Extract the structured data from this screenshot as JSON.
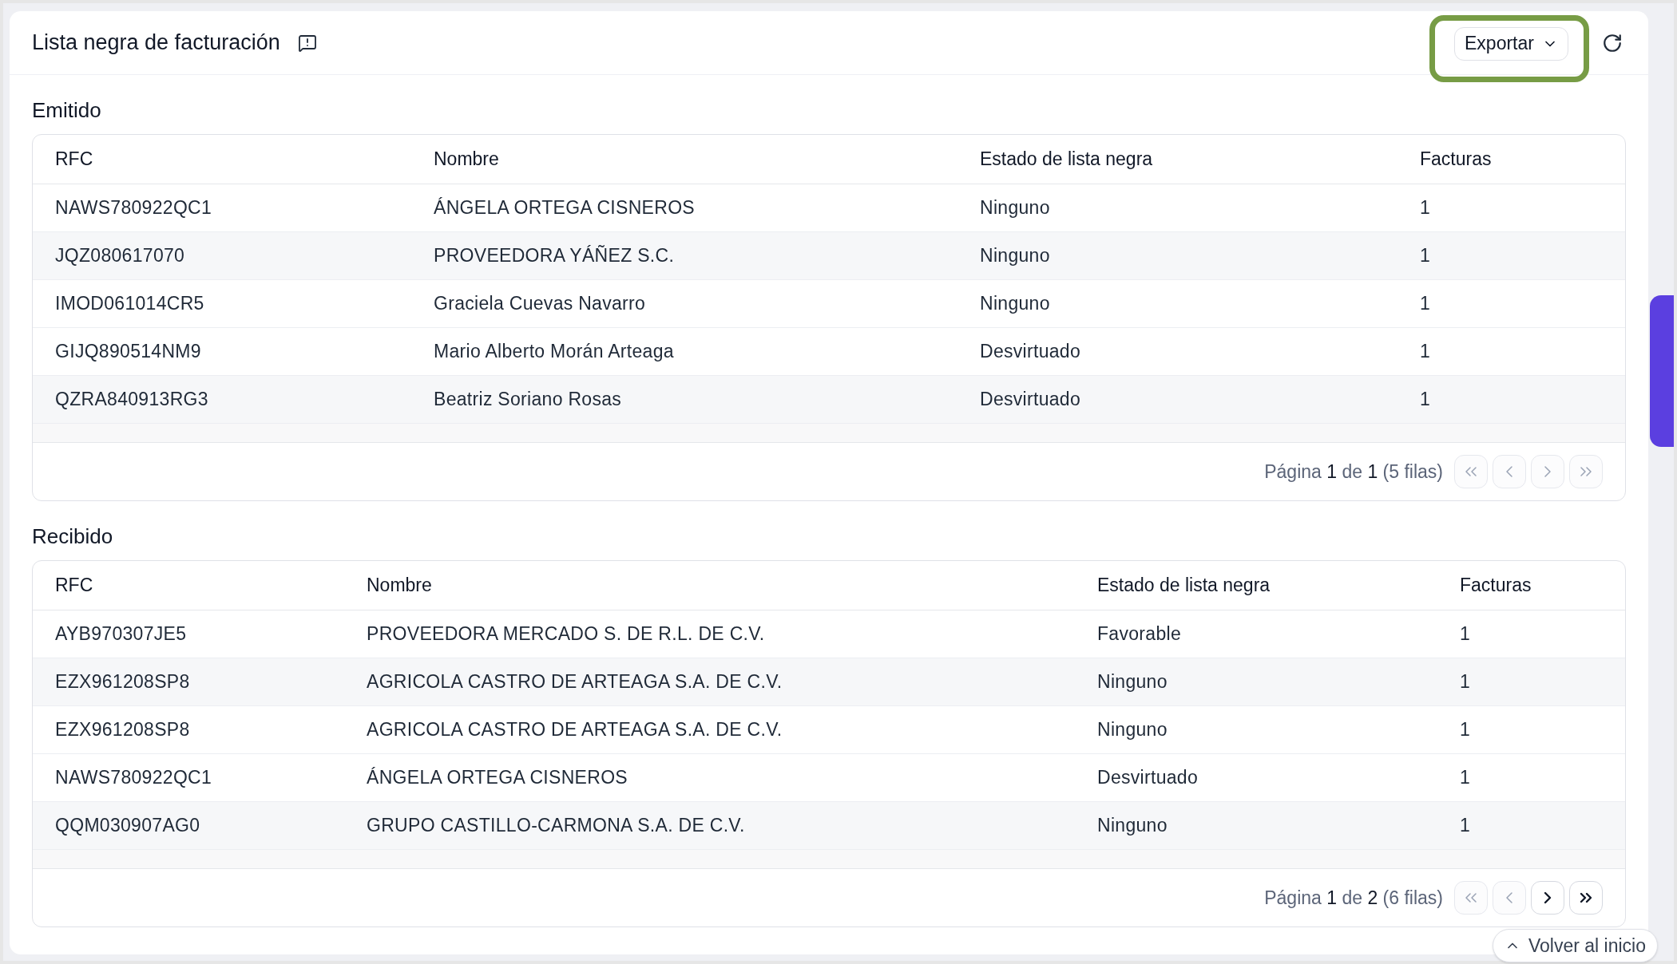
{
  "header": {
    "title": "Lista negra de facturación",
    "export_button": "Exportar"
  },
  "sections": [
    {
      "title": "Emitido",
      "columns": [
        "RFC",
        "Nombre",
        "Estado de lista negra",
        "Facturas"
      ],
      "rows": [
        [
          "NAWS780922QC1",
          "ÁNGELA ORTEGA CISNEROS",
          "Ninguno",
          "1"
        ],
        [
          "JQZ080617070",
          "PROVEEDORA YÁÑEZ S.C.",
          "Ninguno",
          "1"
        ],
        [
          "IMOD061014CR5",
          "Graciela Cuevas Navarro",
          "Ninguno",
          "1"
        ],
        [
          "GIJQ890514NM9",
          "Mario Alberto Morán Arteaga",
          "Desvirtuado",
          "1"
        ],
        [
          "QZRA840913RG3",
          "Beatriz Soriano Rosas",
          "Desvirtuado",
          "1"
        ]
      ],
      "pagination": {
        "label": "Página",
        "page": "1",
        "of": "de",
        "total": "1",
        "rows": "(5 filas)",
        "first_disabled": true,
        "prev_disabled": true,
        "next_disabled": true,
        "last_disabled": true
      }
    },
    {
      "title": "Recibido",
      "columns": [
        "RFC",
        "Nombre",
        "Estado de lista negra",
        "Facturas"
      ],
      "rows": [
        [
          "AYB970307JE5",
          "PROVEEDORA MERCADO S. DE R.L. DE C.V.",
          "Favorable",
          "1"
        ],
        [
          "EZX961208SP8",
          "AGRICOLA CASTRO DE ARTEAGA S.A. DE C.V.",
          "Ninguno",
          "1"
        ],
        [
          "EZX961208SP8",
          "AGRICOLA CASTRO DE ARTEAGA S.A. DE C.V.",
          "Ninguno",
          "1"
        ],
        [
          "NAWS780922QC1",
          "ÁNGELA ORTEGA CISNEROS",
          "Desvirtuado",
          "1"
        ],
        [
          "QQM030907AG0",
          "GRUPO CASTILLO-CARMONA S.A. DE C.V.",
          "Ninguno",
          "1"
        ]
      ],
      "pagination": {
        "label": "Página",
        "page": "1",
        "of": "de",
        "total": "2",
        "rows": "(6 filas)",
        "first_disabled": true,
        "prev_disabled": true,
        "next_disabled": false,
        "last_disabled": false
      }
    }
  ],
  "back_to_top": "Volver al inicio"
}
